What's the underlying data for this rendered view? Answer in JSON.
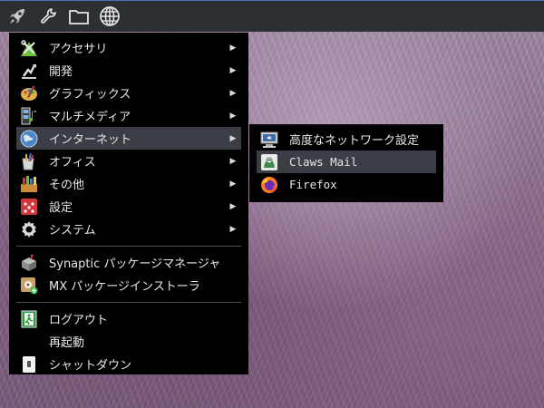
{
  "panel": {
    "buttons": [
      {
        "icon": "rocket-icon"
      },
      {
        "icon": "wrench-icon"
      },
      {
        "icon": "folder-icon"
      },
      {
        "icon": "globe-icon"
      }
    ],
    "accent_color": "#4a6fb5"
  },
  "main_menu": {
    "items": [
      {
        "label": "アクセサリ",
        "icon": "accessories-icon",
        "has_submenu": true
      },
      {
        "label": "開発",
        "icon": "development-icon",
        "has_submenu": true
      },
      {
        "label": "グラフィックス",
        "icon": "graphics-icon",
        "has_submenu": true
      },
      {
        "label": "マルチメディア",
        "icon": "multimedia-icon",
        "has_submenu": true
      },
      {
        "label": "インターネット",
        "icon": "internet-icon",
        "has_submenu": true,
        "active": true
      },
      {
        "label": "オフィス",
        "icon": "office-icon",
        "has_submenu": true
      },
      {
        "label": "その他",
        "icon": "other-icon",
        "has_submenu": true
      },
      {
        "label": "設定",
        "icon": "settings-icon",
        "has_submenu": true
      },
      {
        "label": "システム",
        "icon": "system-icon",
        "has_submenu": true
      }
    ],
    "apps": [
      {
        "label": "Synaptic パッケージマネージャ",
        "icon": "synaptic-icon"
      },
      {
        "label": "MX パッケージインストーラ",
        "icon": "mx-installer-icon"
      }
    ],
    "session": [
      {
        "label": "ログアウト",
        "icon": "logout-icon"
      },
      {
        "label": "再起動",
        "icon": ""
      },
      {
        "label": "シャットダウン",
        "icon": "shutdown-icon"
      }
    ],
    "arrow_glyph": "▶"
  },
  "internet_submenu": {
    "items": [
      {
        "label": "高度なネットワーク設定",
        "icon": "network-settings-icon"
      },
      {
        "label": "Claws Mail",
        "icon": "claws-mail-icon",
        "active": true
      },
      {
        "label": "Firefox",
        "icon": "firefox-icon"
      }
    ]
  }
}
